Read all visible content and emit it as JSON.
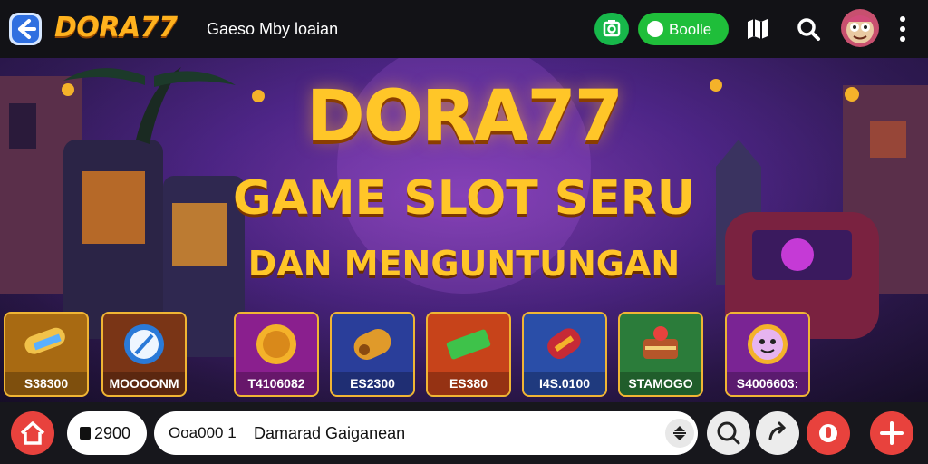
{
  "header": {
    "logo": "DORA77",
    "subtitle": "Gaeso Mby loaian",
    "doodle_label": "Boolle",
    "icons": {
      "back": "back-arrow-icon",
      "camera": "camera-icon",
      "map": "map-icon",
      "search": "search-icon",
      "menu": "more-vertical-icon"
    }
  },
  "banner": {
    "headline": "DORA77",
    "tagline": "GAME SLOT SERU",
    "tagline2": "DAN MENGUNTUNGAN"
  },
  "tiles": [
    {
      "caption": "S38300",
      "icon": "golden-scroll-icon",
      "color": "#a86a12"
    },
    {
      "caption": "MOOOONM",
      "icon": "blue-feather-icon",
      "color": "#7a3516"
    },
    {
      "caption": "T4106082",
      "icon": "golden-coin-icon",
      "color": "#8a1f8e"
    },
    {
      "caption": "ES2300",
      "icon": "golden-barrel-icon",
      "color": "#2a3e9a"
    },
    {
      "caption": "ES380",
      "icon": "green-ticket-icon",
      "color": "#c7431a"
    },
    {
      "caption": "I4S.0100",
      "icon": "red-cannon-icon",
      "color": "#2a4ea8"
    },
    {
      "caption": "STAMOGO",
      "icon": "cake-treasure-icon",
      "color": "#2b7c3a"
    },
    {
      "caption": "S4006603:",
      "icon": "smiling-face-icon",
      "color": "#7a2494"
    }
  ],
  "bottom": {
    "coins": "2900",
    "search_prefix": "Ooa000 1",
    "search_value": "Damarad Gaiganean",
    "icons": {
      "home": "home-icon",
      "sort": "sort-icon",
      "zoom": "zoom-icon",
      "share": "share-icon",
      "record": "record-icon",
      "add": "plus-icon"
    }
  },
  "colors": {
    "accent_gold": "#ffc628",
    "green": "#1fbe3a",
    "red": "#e8423d",
    "banner_purple": "#5b2a9a"
  }
}
